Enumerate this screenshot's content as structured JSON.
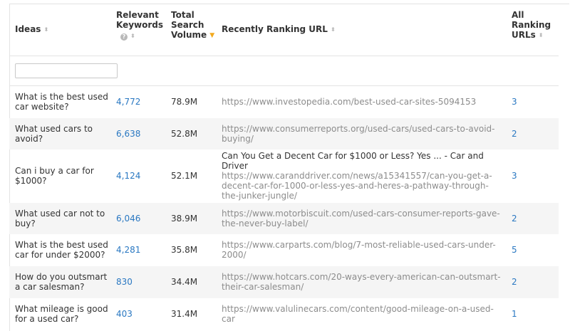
{
  "headers": {
    "ideas": "Ideas",
    "relevant_keywords_line1": "Relevant",
    "relevant_keywords_line2": "Keywords",
    "total_volume_line1": "Total",
    "total_volume_line2": "Search",
    "total_volume_line3": "Volume",
    "recent_url": "Recently Ranking URL",
    "all_urls_line1": "All",
    "all_urls_line2": "Ranking",
    "all_urls_line3": "URLs"
  },
  "icons": {
    "sort": "⬍",
    "sort_active": "▼",
    "help": "?"
  },
  "colors": {
    "link": "#2a78c2",
    "url": "#8c8c8c",
    "sort_active": "#f2a91e",
    "row_alt": "#f5f5f5"
  },
  "filter": {
    "placeholder": ""
  },
  "rows": [
    {
      "idea": "What is the best used car website?",
      "keywords": "4,772",
      "volume": "78.9M",
      "url_title": "",
      "url": "https://www.investopedia.com/best-used-car-sites-5094153",
      "count": "3"
    },
    {
      "idea": "What used cars to avoid?",
      "keywords": "6,638",
      "volume": "52.8M",
      "url_title": "",
      "url": "https://www.consumerreports.org/used-cars/used-cars-to-avoid-buying/",
      "count": "2"
    },
    {
      "idea": "Can i buy a car for $1000?",
      "keywords": "4,124",
      "volume": "52.1M",
      "url_title": "Can You Get a Decent Car for $1000 or Less? Yes ... - Car and Driver",
      "url": "https://www.caranddriver.com/news/a15341557/can-you-get-a-decent-car-for-1000-or-less-yes-and-heres-a-pathway-through-the-junker-jungle/",
      "count": "3"
    },
    {
      "idea": "What used car not to buy?",
      "keywords": "6,046",
      "volume": "38.9M",
      "url_title": "",
      "url": "https://www.motorbiscuit.com/used-cars-consumer-reports-gave-the-never-buy-label/",
      "count": "2"
    },
    {
      "idea": "What is the best used car for under $2000?",
      "keywords": "4,281",
      "volume": "35.8M",
      "url_title": "",
      "url": "https://www.carparts.com/blog/7-most-reliable-used-cars-under-2000/",
      "count": "5"
    },
    {
      "idea": "How do you outsmart a car salesman?",
      "keywords": "830",
      "volume": "34.4M",
      "url_title": "",
      "url": "https://www.hotcars.com/20-ways-every-american-can-outsmart-their-car-salesman/",
      "count": "2"
    },
    {
      "idea": "What mileage is good for a used car?",
      "keywords": "403",
      "volume": "31.4M",
      "url_title": "",
      "url": "https://www.valulinecars.com/content/good-mileage-on-a-used-car",
      "count": "1"
    }
  ]
}
